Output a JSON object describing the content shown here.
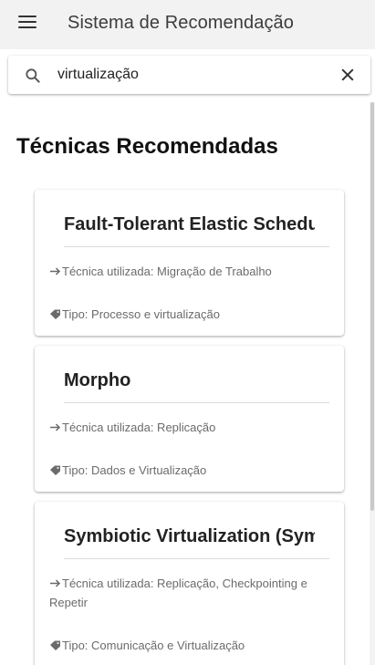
{
  "app": {
    "title": "Sistema de Recomendação"
  },
  "search": {
    "value": "virtualização"
  },
  "section": {
    "title": "Técnicas Recomendadas"
  },
  "cards": [
    {
      "title": "Fault-Tolerant Elastic Scheduling",
      "tecnica": "Técnica utilizada: Migração de Trabalho",
      "tipo": "Tipo: Processo e virtualização"
    },
    {
      "title": "Morpho",
      "tecnica": "Técnica utilizada: Replicação",
      "tipo": "Tipo: Dados e Virtualização"
    },
    {
      "title": "Symbiotic Virtualization (SymVirt)",
      "tecnica": "Técnica utilizada: Replicação, Checkpointing e Repetir",
      "tipo": "Tipo: Comunicação e Virtualização"
    }
  ]
}
